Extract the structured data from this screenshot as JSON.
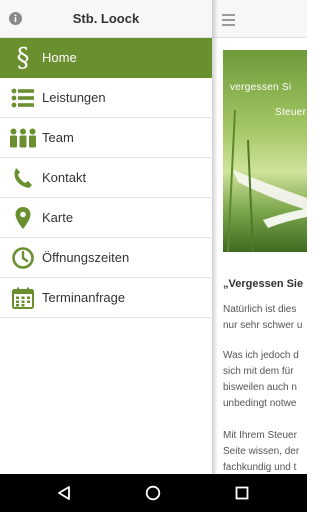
{
  "drawer": {
    "title": "Stb. Loock",
    "items": [
      {
        "label": "Home",
        "icon": "section-icon",
        "active": true
      },
      {
        "label": "Leistungen",
        "icon": "list-icon"
      },
      {
        "label": "Team",
        "icon": "team-icon"
      },
      {
        "label": "Kontakt",
        "icon": "phone-icon"
      },
      {
        "label": "Karte",
        "icon": "map-pin-icon"
      },
      {
        "label": "Öffnungszeiten",
        "icon": "clock-icon"
      },
      {
        "label": "Terminanfrage",
        "icon": "calendar-icon"
      }
    ]
  },
  "content": {
    "hero_line1": "vergessen Si",
    "hero_line2": "Steuer",
    "heading": "„Vergessen Sie",
    "para1": [
      "Natürlich ist dies",
      "nur sehr schwer u"
    ],
    "para2": [
      "Was ich jedoch d",
      "sich mit dem für",
      "bisweilen auch n",
      "unbedingt notwe"
    ],
    "para3": [
      "Mit Ihrem Steuer",
      "Seite wissen, der",
      "fachkundig und t"
    ]
  },
  "colors": {
    "accent": "#6a8f2e",
    "navbar": "#000000"
  }
}
